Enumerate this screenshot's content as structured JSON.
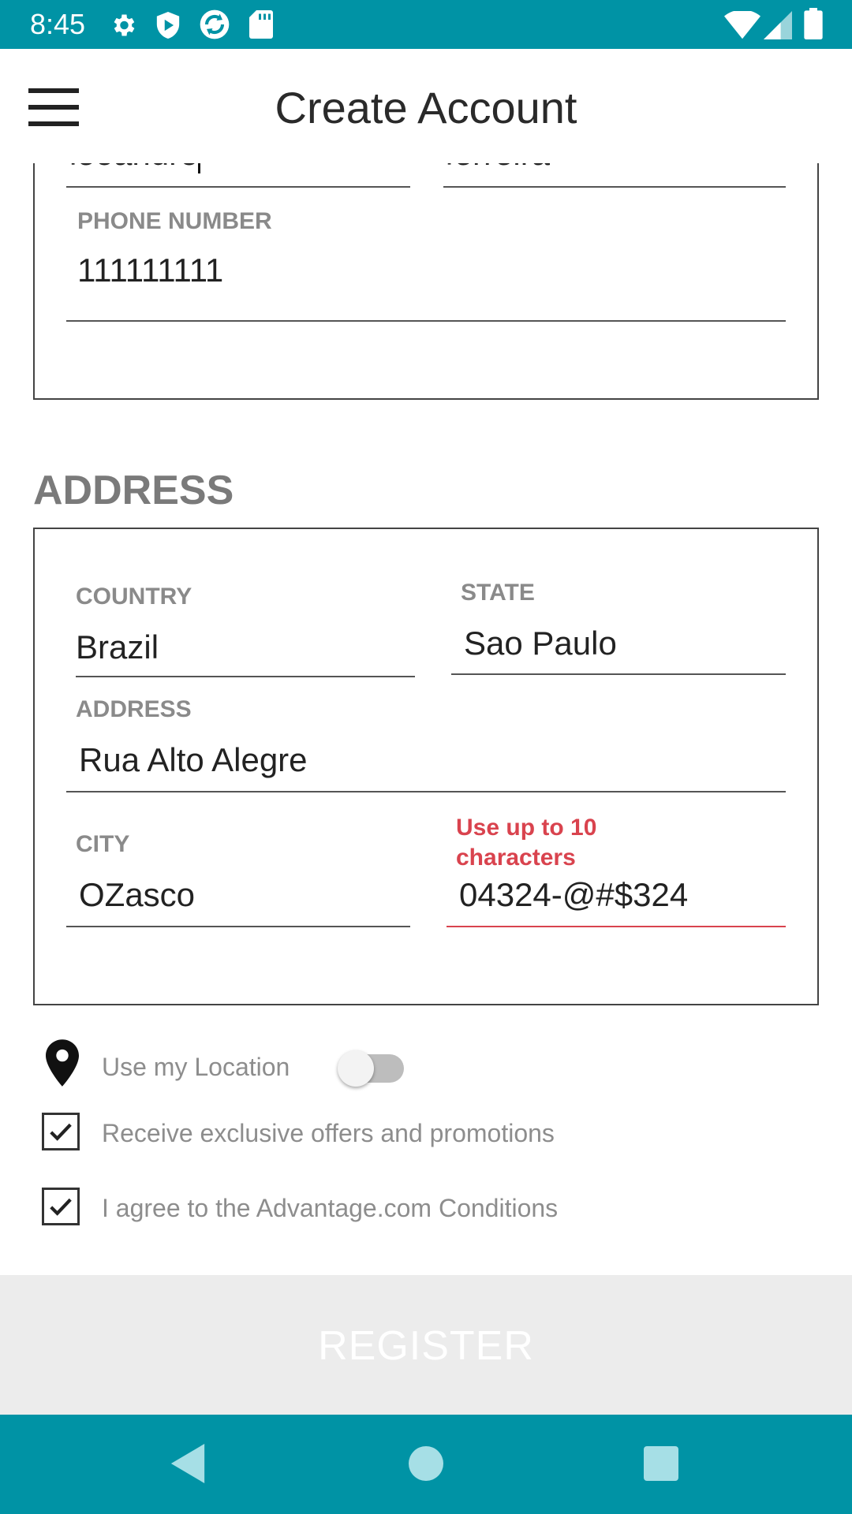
{
  "status_bar": {
    "time": "8:45",
    "icons_left": [
      "gear-icon",
      "shield-icon",
      "sync-icon",
      "sd-card-icon"
    ],
    "icons_right": [
      "wifi-icon",
      "signal-icon",
      "battery-icon"
    ]
  },
  "app_bar": {
    "title": "Create Account",
    "menu_icon": "hamburger-menu-icon"
  },
  "personal": {
    "first_name_value": "leoandro",
    "last_name_value": "ferreira",
    "phone_label": "PHONE NUMBER",
    "phone_value": "111111111"
  },
  "address_section": {
    "title": "ADDRESS",
    "country_label": "COUNTRY",
    "country_value": "Brazil",
    "state_label": "STATE",
    "state_value": "Sao Paulo",
    "address_label": "ADDRESS",
    "address_value": "Rua Alto Alegre",
    "city_label": "CITY",
    "city_value": "OZasco",
    "postal_error_line1": "Use up to 10",
    "postal_error_line2": "characters",
    "postal_value": "04324-@#$324"
  },
  "options": {
    "location_icon": "location-pin-icon",
    "use_location_label": "Use my Location",
    "use_location_on": false,
    "offers_label": "Receive exclusive offers and promotions",
    "offers_checked": true,
    "agree_label": "I agree to the Advantage.com Conditions",
    "agree_checked": true
  },
  "register": {
    "label": "REGISTER"
  },
  "nav_bar": {
    "icons": [
      "back-icon",
      "home-icon",
      "recents-icon"
    ]
  },
  "colors": {
    "primary": "#0093a5",
    "error": "#d9434e",
    "register_bg": "#ececec"
  }
}
